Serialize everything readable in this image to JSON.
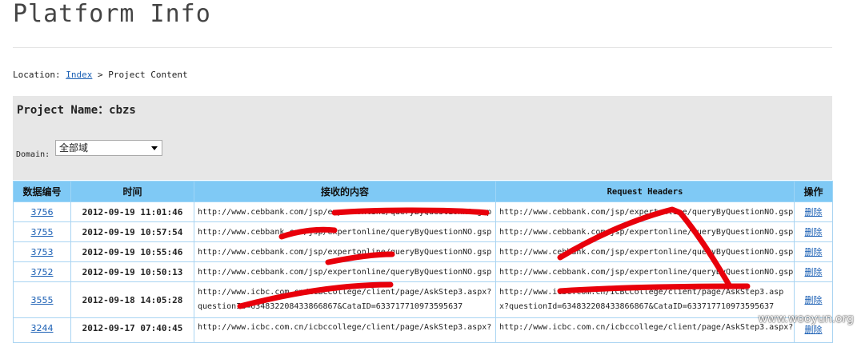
{
  "page": {
    "title": "Platform Info",
    "breadcrumb": {
      "prefix": "Location:",
      "link": "Index",
      "separator": ">",
      "current": "Project Content"
    }
  },
  "project": {
    "label": "Project Name：cbzs",
    "domain_label": "Domain:",
    "domain_value": "全部域"
  },
  "table": {
    "headers": [
      "数据编号",
      "时间",
      "接收的内容",
      "Request Headers",
      "操作"
    ],
    "rows": [
      {
        "id": "3756",
        "time": "2012-09-19 11:01:46",
        "content": "http://www.cebbank.com/jsp/expertonline/queryByQuestionNO.gsp",
        "headers": "http://www.cebbank.com/jsp/expertonline/queryByQuestionNO.gsp",
        "op": "删除"
      },
      {
        "id": "3755",
        "time": "2012-09-19 10:57:54",
        "content": "http://www.cebbank.com/jsp/expertonline/queryByQuestionNO.gsp",
        "headers": "http://www.cebbank.com/jsp/expertonline/queryByQuestionNO.gsp",
        "op": "删除"
      },
      {
        "id": "3753",
        "time": "2012-09-19 10:55:46",
        "content": "http://www.cebbank.com/jsp/expertonline/queryByQuestionNO.gsp",
        "headers": "http://www.cebbank.com/jsp/expertonline/queryByQuestionNO.gsp",
        "op": "删除"
      },
      {
        "id": "3752",
        "time": "2012-09-19 10:50:13",
        "content": "http://www.cebbank.com/jsp/expertonline/queryByQuestionNO.gsp",
        "headers": "http://www.cebbank.com/jsp/expertonline/queryByQuestionNO.gsp",
        "op": "删除"
      },
      {
        "id": "3555",
        "time": "2012-09-18 14:05:28",
        "content": "http://www.icbc.com.cn/ICBCCollege/client/page/AskStep3.aspx?questionId=634832208433866867&CataID=633717710973595637",
        "headers": "http://www.icbc.com.cn/ICBCCollege/client/page/AskStep3.aspx?questionId=634832208433866867&CataID=633717710973595637",
        "op": "删除"
      },
      {
        "id": "3244",
        "time": "2012-09-17 07:40:45",
        "content": "http://www.icbc.com.cn/icbccollege/client/page/AskStep3.aspx?",
        "headers": "http://www.icbc.com.cn/icbccollege/client/page/AskStep3.aspx?",
        "op": "删除"
      }
    ]
  },
  "watermark": "www.wooyun.org",
  "colors": {
    "header_bg": "#7fc9f5",
    "panel_bg": "#e7e7e7",
    "link": "#1a5fb4",
    "redaction": "#e8000b"
  }
}
